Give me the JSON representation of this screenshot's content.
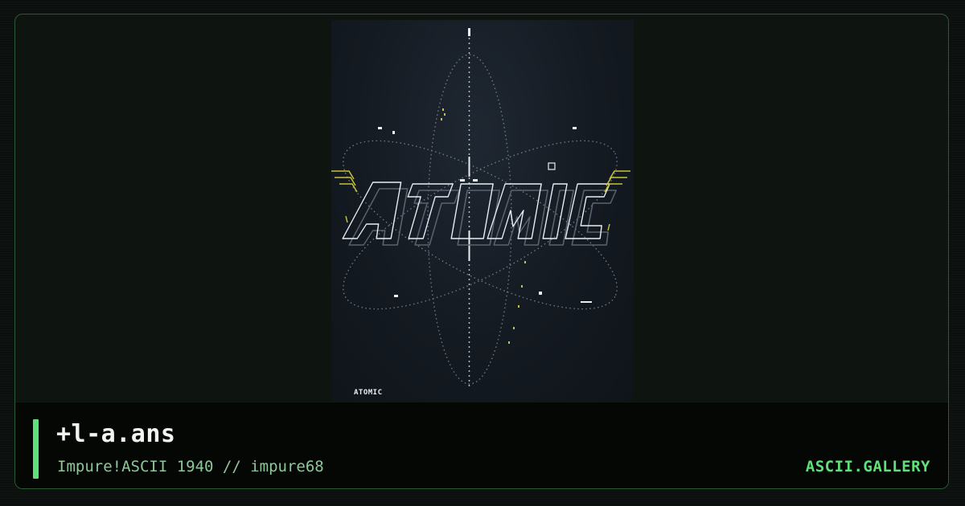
{
  "artwork": {
    "tag": "ATOMIC",
    "credit": "",
    "palette": {
      "background": "#141a21",
      "lines": "#e9eef2",
      "dots": "#8a94a3",
      "accent_yellow": "#c8c23a"
    }
  },
  "caption": {
    "filename": "+l-a.ans",
    "subtitle": "Impure!ASCII 1940 // impure68",
    "brand": "ASCII.GALLERY"
  },
  "colors": {
    "page_background": "#0b0f0d",
    "frame_border": "#2d5a36",
    "accent": "#5ee07b",
    "subtitle": "#8fc79b"
  }
}
